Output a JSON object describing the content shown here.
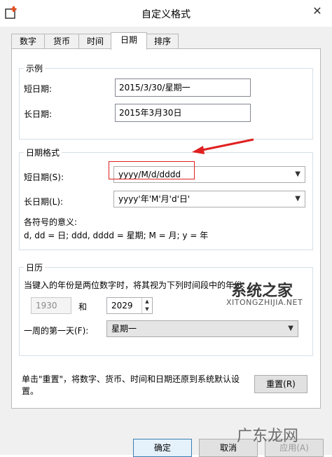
{
  "window": {
    "title": "自定义格式"
  },
  "tabs": [
    {
      "label": "数字"
    },
    {
      "label": "货币"
    },
    {
      "label": "时间"
    },
    {
      "label": "日期"
    },
    {
      "label": "排序"
    }
  ],
  "sample": {
    "legend": "示例",
    "short_label": "短日期:",
    "short_value": "2015/3/30/星期一",
    "long_label": "长日期:",
    "long_value": "2015年3月30日"
  },
  "format": {
    "legend": "日期格式",
    "short_label": "短日期(S):",
    "short_value": "yyyy/M/d/dddd",
    "long_label": "长日期(L):",
    "long_value": "yyyy'年'M'月'd'日'",
    "symbols_title": "各符号的意义:",
    "symbols_desc": "d, dd = 日;  ddd, dddd = 星期;  M = 月;  y = 年"
  },
  "calendar": {
    "legend": "日历",
    "desc": "当键入的年份是两位数字时，将其视为下列时间段中的年份:",
    "from_year": "1930",
    "and_label": "和",
    "to_year": "2029",
    "first_day_label": "一周的第一天(F):",
    "first_day_value": "星期一"
  },
  "footer": {
    "reset_desc": "单击\"重置\"，将数字、货币、时间和日期还原到系统默认设置。",
    "reset_label": "重置(R)",
    "ok_label": "确定",
    "cancel_label": "取消",
    "apply_label": "应用(A)"
  },
  "watermarks": {
    "site_name": "系统之家",
    "site_url": "XITONGZHIJIA.NET",
    "site2": "广东龙网"
  },
  "colors": {
    "highlight_box": "#e02020",
    "arrow": "#e02020"
  }
}
